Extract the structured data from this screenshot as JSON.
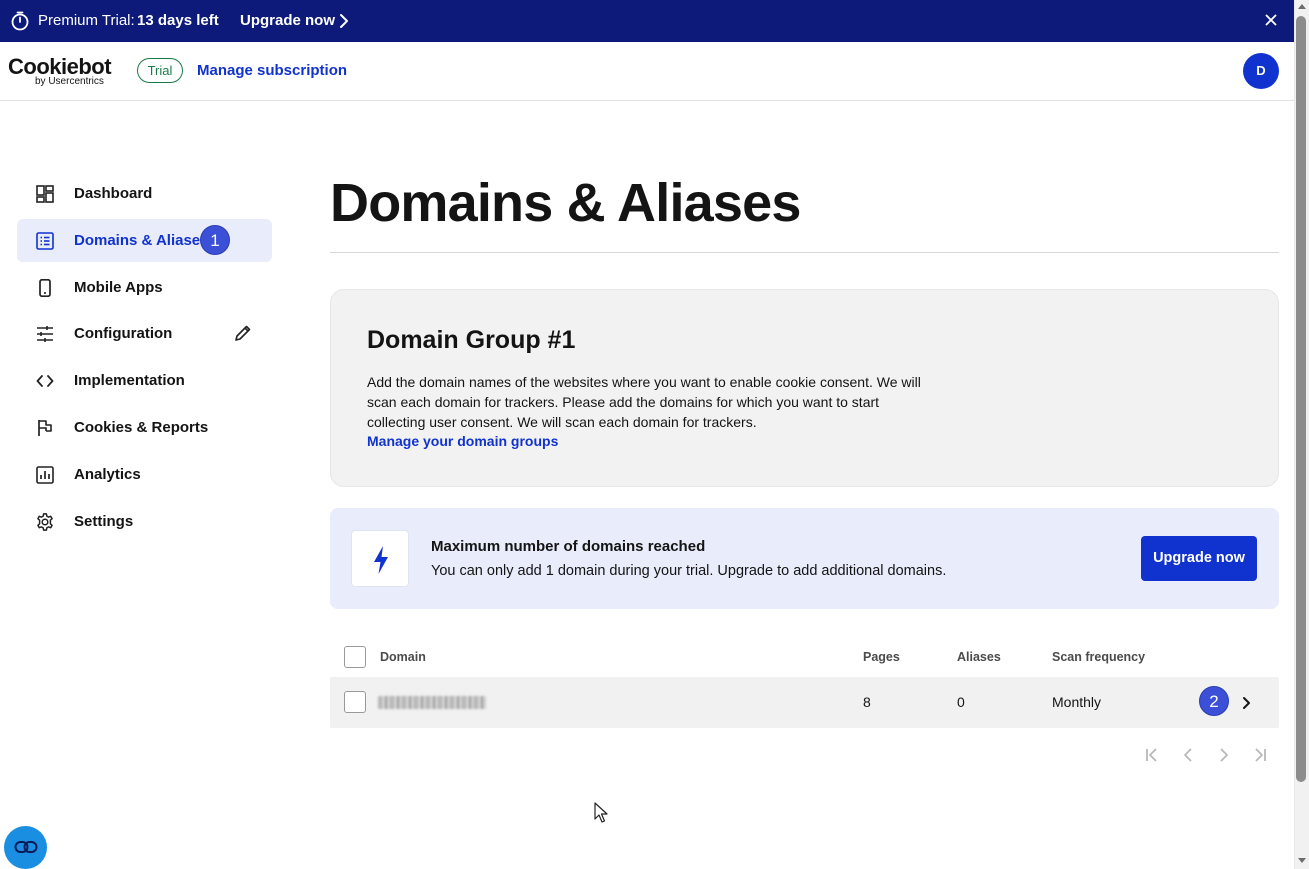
{
  "trial_banner": {
    "label": "Premium Trial:",
    "days_left": "13 days left",
    "upgrade_link": "Upgrade now",
    "icons": {
      "timer": "timer-icon",
      "chevron": "chevron-right-icon",
      "close": "close-icon"
    }
  },
  "header": {
    "logo_main": "Cookiebot",
    "logo_sub": "by Usercentrics",
    "trial_badge": "Trial",
    "manage_subscription": "Manage subscription",
    "avatar_initial": "D"
  },
  "sidebar": {
    "items": [
      {
        "label": "Dashboard",
        "icon": "dashboard-icon"
      },
      {
        "label": "Domains & Aliases",
        "icon": "list-icon",
        "active": true,
        "badge": "1"
      },
      {
        "label": "Mobile Apps",
        "icon": "mobile-icon"
      },
      {
        "label": "Configuration",
        "icon": "sliders-icon",
        "trailing_icon": "pencil-icon"
      },
      {
        "label": "Implementation",
        "icon": "code-icon"
      },
      {
        "label": "Cookies & Reports",
        "icon": "flag-icon"
      },
      {
        "label": "Analytics",
        "icon": "bar-chart-icon"
      },
      {
        "label": "Settings",
        "icon": "gear-icon"
      }
    ]
  },
  "main": {
    "title": "Domains & Aliases",
    "group": {
      "title": "Domain Group #1",
      "description": "Add the domain names of the websites where you want to enable cookie consent. We will scan each domain for trackers. Please add the domains for which you want to start collecting user consent. We will scan each domain for trackers.",
      "manage_link": "Manage your domain groups"
    },
    "limit_notice": {
      "icon": "lightning-icon",
      "title": "Maximum number of domains reached",
      "text": "You can only add 1 domain during your trial. Upgrade to add additional domains.",
      "button": "Upgrade now"
    },
    "table": {
      "columns": [
        "Domain",
        "Pages",
        "Aliases",
        "Scan frequency"
      ],
      "rows": [
        {
          "domain": "",
          "pages": "8",
          "aliases": "0",
          "scan_frequency": "Monthly",
          "badge": "2"
        }
      ]
    }
  },
  "colors": {
    "banner_bg": "#0d1a7a",
    "primary": "#1032cf",
    "active_nav_bg": "#e8ecfb",
    "trial_green": "#1b7a4a"
  }
}
